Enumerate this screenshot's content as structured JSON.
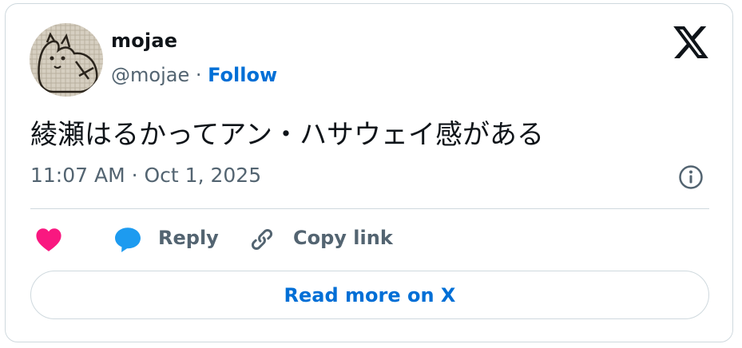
{
  "author": {
    "name": "mojae",
    "handle": "@mojae",
    "separator": " · ",
    "follow_label": "Follow"
  },
  "icons": {
    "x_logo": "x-logo-icon",
    "info": "info-icon",
    "like": "heart-icon",
    "reply": "reply-bubble-icon",
    "copy_link": "link-icon"
  },
  "tweet": {
    "text": "綾瀬はるかってアン・ハサウェイ感がある",
    "timestamp": "11:07 AM · Oct 1, 2025"
  },
  "actions": {
    "reply_label": "Reply",
    "copy_link_label": "Copy link"
  },
  "read_more_label": "Read more on X",
  "colors": {
    "like": "#f91880",
    "reply": "#1d9bf0",
    "link_accent": "#006fd6",
    "secondary_text": "#536471",
    "border": "#cfd9de"
  }
}
